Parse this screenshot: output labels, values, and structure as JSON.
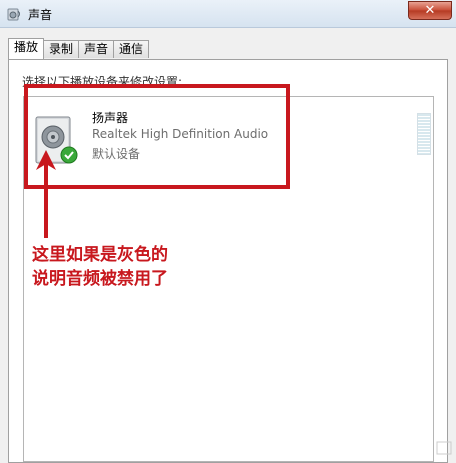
{
  "window": {
    "title": "声音",
    "close_label": "✕"
  },
  "tabs": [
    {
      "label": "播放",
      "active": true
    },
    {
      "label": "录制",
      "active": false
    },
    {
      "label": "声音",
      "active": false
    },
    {
      "label": "通信",
      "active": false
    }
  ],
  "instruction": "选择以下播放设备来修改设置:",
  "device": {
    "name": "扬声器",
    "description": "Realtek High Definition Audio",
    "status": "默认设备",
    "default_check": true
  },
  "annotation": {
    "line1": "这里如果是灰色的",
    "line2": "说明音频被禁用了",
    "color": "#c8181e"
  },
  "icons": [
    "speaker-icon",
    "check-icon",
    "close-icon",
    "arrow-icon"
  ]
}
